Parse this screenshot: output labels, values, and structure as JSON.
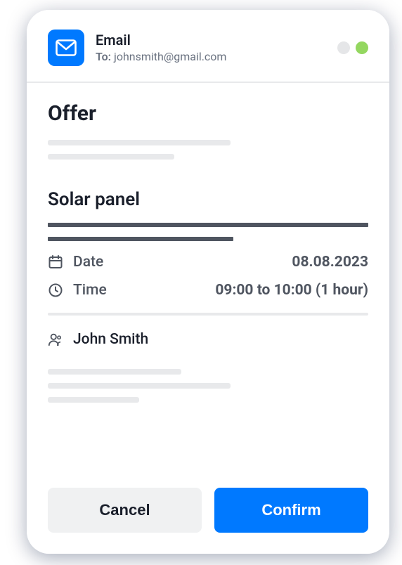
{
  "header": {
    "title": "Email",
    "to_label": "To:",
    "to_value": "johnsmith@gmail.com"
  },
  "content": {
    "section_title": "Offer",
    "item_title": "Solar panel",
    "date_label": "Date",
    "date_value": "08.08.2023",
    "time_label": "Time",
    "time_value": "09:00 to 10:00 (1 hour)",
    "person_name": "John Smith"
  },
  "actions": {
    "cancel": "Cancel",
    "confirm": "Confirm"
  }
}
